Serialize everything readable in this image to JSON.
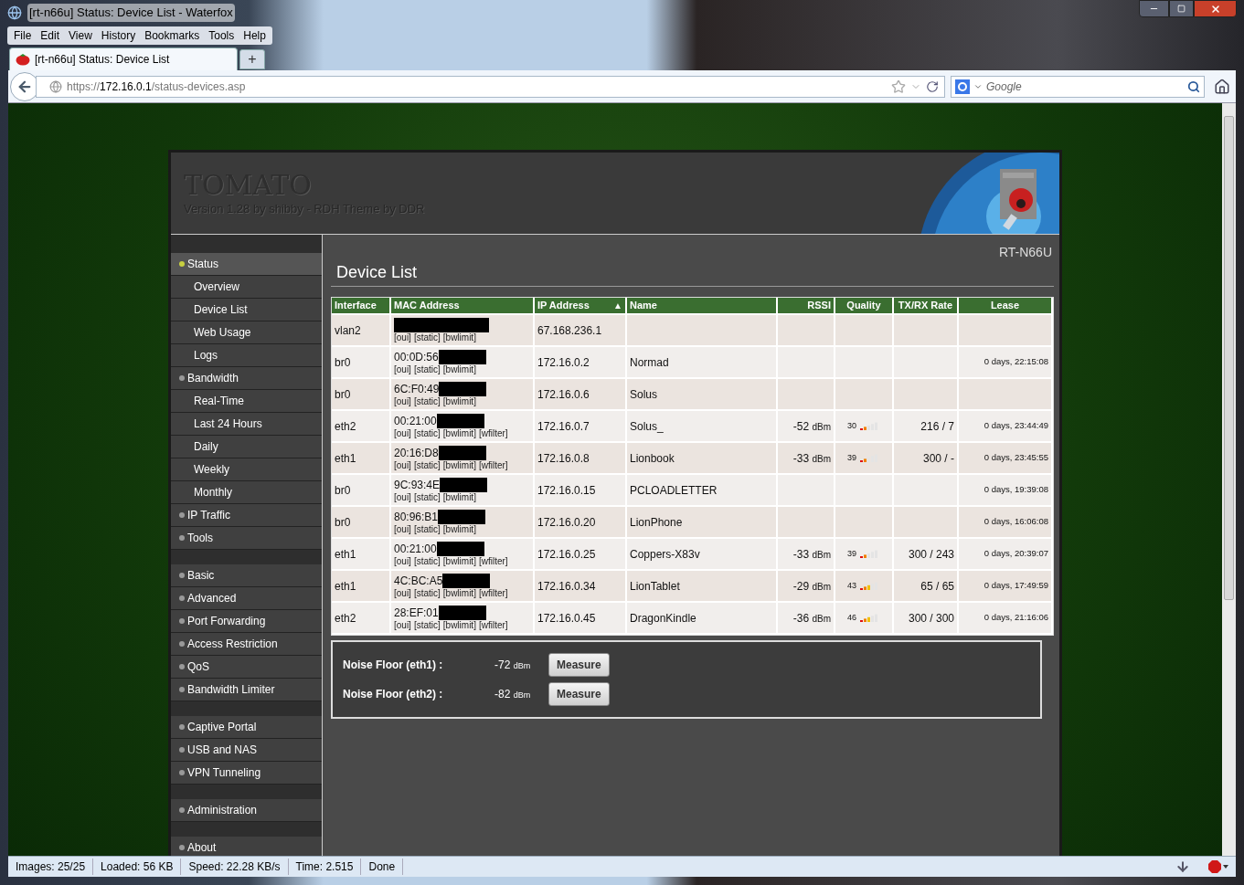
{
  "window": {
    "title": "[rt-n66u] Status: Device List - Waterfox"
  },
  "menu": [
    "File",
    "Edit",
    "View",
    "History",
    "Bookmarks",
    "Tools",
    "Help"
  ],
  "tabs": [
    {
      "label": "[rt-n66u] Status: Device List",
      "selected": true
    }
  ],
  "new_tab": "+",
  "address_bar": {
    "scheme": "https://",
    "host": "172.16.0.1",
    "path": "/status-devices.asp"
  },
  "search": {
    "placeholder": "Google"
  },
  "header": {
    "title": "TOMATO",
    "subtitle": "Version 1.28 by shibby - RDH Theme by DDR",
    "model": "RT-N66U"
  },
  "sidebar": {
    "groups": [
      {
        "items": [
          {
            "label": "Status",
            "kind": "section",
            "selected": true
          },
          {
            "label": "Overview",
            "kind": "page",
            "selected": false
          },
          {
            "label": "Device List",
            "kind": "page",
            "selected": false
          },
          {
            "label": "Web Usage",
            "kind": "page",
            "selected": false
          },
          {
            "label": "Logs",
            "kind": "page",
            "selected": false
          },
          {
            "label": "Bandwidth",
            "kind": "section",
            "selected": false
          },
          {
            "label": "Real-Time",
            "kind": "page",
            "selected": false
          },
          {
            "label": "Last 24 Hours",
            "kind": "page",
            "selected": false
          },
          {
            "label": "Daily",
            "kind": "page",
            "selected": false
          },
          {
            "label": "Weekly",
            "kind": "page",
            "selected": false
          },
          {
            "label": "Monthly",
            "kind": "page",
            "selected": false
          },
          {
            "label": "IP Traffic",
            "kind": "section",
            "selected": false
          },
          {
            "label": "Tools",
            "kind": "section",
            "selected": false
          }
        ]
      },
      {
        "items": [
          {
            "label": "Basic",
            "kind": "section",
            "selected": false
          },
          {
            "label": "Advanced",
            "kind": "section",
            "selected": false
          },
          {
            "label": "Port Forwarding",
            "kind": "section",
            "selected": false
          },
          {
            "label": "Access Restriction",
            "kind": "section",
            "selected": false
          },
          {
            "label": "QoS",
            "kind": "section",
            "selected": false
          },
          {
            "label": "Bandwidth Limiter",
            "kind": "section",
            "selected": false
          }
        ]
      },
      {
        "items": [
          {
            "label": "Captive Portal",
            "kind": "section",
            "selected": false
          },
          {
            "label": "USB and NAS",
            "kind": "section",
            "selected": false
          },
          {
            "label": "VPN Tunneling",
            "kind": "section",
            "selected": false
          }
        ]
      },
      {
        "items": [
          {
            "label": "Administration",
            "kind": "section",
            "selected": false
          }
        ]
      },
      {
        "items": [
          {
            "label": "About",
            "kind": "section",
            "selected": false
          }
        ]
      }
    ]
  },
  "page_title": "Device List",
  "table": {
    "columns": [
      {
        "label": "Interface"
      },
      {
        "label": "MAC Address"
      },
      {
        "label": "IP Address",
        "sort_mark": "▲"
      },
      {
        "label": "Name"
      },
      {
        "label": "RSSI"
      },
      {
        "label": "Quality"
      },
      {
        "label": "TX/RX Rate"
      },
      {
        "label": "Lease"
      }
    ],
    "rows": [
      {
        "interface": "vlan2",
        "links": [
          "[oui]",
          "[static]",
          "[bwlimit]"
        ],
        "ip": "67.168.236.1"
      },
      {
        "interface": "br0",
        "mac": "00:0D:56",
        "links": [
          "[oui]",
          "[static]",
          "[bwlimit]"
        ],
        "ip": "172.16.0.2",
        "name": "Normad",
        "lease": "0 days, 22:15:08"
      },
      {
        "interface": "br0",
        "mac": "6C:F0:49",
        "links": [
          "[oui]",
          "[static]",
          "[bwlimit]"
        ],
        "ip": "172.16.0.6",
        "name": "Solus"
      },
      {
        "interface": "eth2",
        "mac": "00:21:00",
        "links": [
          "[oui]",
          "[static]",
          "[bwlimit]",
          "[wfilter]"
        ],
        "ip": "172.16.0.7",
        "name": "Solus_",
        "rssi": "-52",
        "rssi_unit": "dBm",
        "quality": "30",
        "level": 0.4,
        "rate": "216 / 7",
        "lease": "0 days, 23:44:49"
      },
      {
        "interface": "eth1",
        "mac": "20:16:D8",
        "links": [
          "[oui]",
          "[static]",
          "[bwlimit]",
          "[wfilter]"
        ],
        "ip": "172.16.0.8",
        "name": "Lionbook",
        "rssi": "-33",
        "rssi_unit": "dBm",
        "quality": "39",
        "level": 0.4,
        "rate": "300 / -",
        "lease": "0 days, 23:45:55"
      },
      {
        "interface": "br0",
        "mac": "9C:93:4E",
        "links": [
          "[oui]",
          "[static]",
          "[bwlimit]"
        ],
        "ip": "172.16.0.15",
        "name": "PCLOADLETTER",
        "lease": "0 days, 19:39:08"
      },
      {
        "interface": "br0",
        "mac": "80:96:B1",
        "links": [
          "[oui]",
          "[static]",
          "[bwlimit]"
        ],
        "ip": "172.16.0.20",
        "name": "LionPhone",
        "lease": "0 days, 16:06:08"
      },
      {
        "interface": "eth1",
        "mac": "00:21:00",
        "links": [
          "[oui]",
          "[static]",
          "[bwlimit]",
          "[wfilter]"
        ],
        "ip": "172.16.0.25",
        "name": "Coppers-X83v",
        "rssi": "-33",
        "rssi_unit": "dBm",
        "quality": "39",
        "level": 0.4,
        "rate": "300 / 243",
        "lease": "0 days, 20:39:07"
      },
      {
        "interface": "eth1",
        "mac": "4C:BC:A5",
        "links": [
          "[oui]",
          "[static]",
          "[bwlimit]",
          "[wfilter]"
        ],
        "ip": "172.16.0.34",
        "name": "LionTablet",
        "rssi": "-29",
        "rssi_unit": "dBm",
        "quality": "43",
        "level": 0.6,
        "rate": "65 / 65",
        "lease": "0 days, 17:49:59"
      },
      {
        "interface": "eth2",
        "mac": "28:EF:01",
        "links": [
          "[oui]",
          "[static]",
          "[bwlimit]",
          "[wfilter]"
        ],
        "ip": "172.16.0.45",
        "name": "DragonKindle",
        "rssi": "-36",
        "rssi_unit": "dBm",
        "quality": "46",
        "level": 0.6,
        "rate": "300 / 300",
        "lease": "0 days, 21:16:06"
      }
    ]
  },
  "noise_floor": [
    {
      "label": "Noise Floor (eth1) :",
      "value": "-72",
      "unit": "dBm",
      "button": "Measure"
    },
    {
      "label": "Noise Floor (eth2) :",
      "value": "-82",
      "unit": "dBm",
      "button": "Measure"
    }
  ],
  "status_bar": [
    "Images: 25/25",
    "Loaded: 56 KB",
    "Speed: 22.28 KB/s",
    "Time: 2.515",
    "Done"
  ]
}
